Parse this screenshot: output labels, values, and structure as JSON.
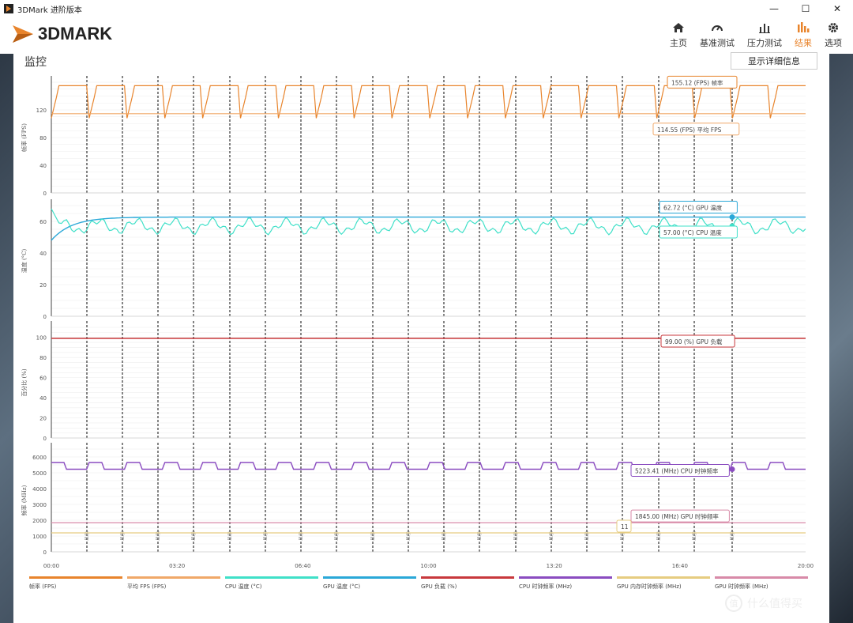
{
  "window": {
    "title": "3DMark 进阶版本",
    "min": "—",
    "max": "☐",
    "close": "✕"
  },
  "header": {
    "logo_text": "3DMARK"
  },
  "nav": [
    {
      "label": "主页",
      "icon": "home-icon"
    },
    {
      "label": "基准测试",
      "icon": "gauge-icon"
    },
    {
      "label": "压力测试",
      "icon": "bars-icon"
    },
    {
      "label": "结果",
      "icon": "results-icon",
      "active": true
    },
    {
      "label": "选项",
      "icon": "gear-icon"
    }
  ],
  "panel": {
    "title": "监控",
    "detail_button": "显示详细信息"
  },
  "colors": {
    "fps": "#e8842c",
    "fps_avg": "#f0a868",
    "cpu_temp": "#3fe0c8",
    "gpu_temp": "#2aa8d8",
    "gpu_load": "#c8383c",
    "cpu_clock": "#8a4cc0",
    "gpu_mem_clock": "#e6cc80",
    "gpu_clock": "#d88aa8",
    "accent": "#e8842c"
  },
  "x_axis": {
    "ticks": [
      "00:00",
      "03:20",
      "06:40",
      "10:00",
      "13:20",
      "16:40",
      "20:00"
    ]
  },
  "marker_label": "显示",
  "charts": [
    {
      "id": "fps",
      "ylabel": "帧率 (FPS)",
      "yticks": [
        "0",
        "40",
        "80",
        "120"
      ],
      "callouts": [
        {
          "text": "155.12 (FPS) 帧率",
          "color": "#e8842c"
        },
        {
          "text": "114.55 (FPS) 平均 FPS",
          "color": "#f0a868"
        }
      ]
    },
    {
      "id": "temp",
      "ylabel": "温度 (°C)",
      "yticks": [
        "0",
        "20",
        "40",
        "60"
      ],
      "callouts": [
        {
          "text": "62.72 (°C) GPU 温度",
          "color": "#2aa8d8"
        },
        {
          "text": "57.00 (°C) CPU 温度",
          "color": "#3fe0c8"
        }
      ]
    },
    {
      "id": "load",
      "ylabel": "百分比 (%)",
      "yticks": [
        "0",
        "20",
        "40",
        "60",
        "80",
        "100"
      ],
      "callouts": [
        {
          "text": "99.00 (%) GPU 负载",
          "color": "#c8383c"
        }
      ]
    },
    {
      "id": "clock",
      "ylabel": "频率 (MHz)",
      "yticks": [
        "0",
        "1000",
        "2000",
        "3000",
        "4000",
        "5000",
        "6000"
      ],
      "callouts": [
        {
          "text": "5223.41 (MHz) CPU 时钟频率",
          "color": "#8a4cc0"
        },
        {
          "text": "1845.00 (MHz) GPU 时钟频率",
          "color": "#d88aa8"
        },
        {
          "text": "11",
          "color": "#e6cc80"
        }
      ]
    }
  ],
  "legend": [
    {
      "label": "帧率 (FPS)",
      "color": "#e8842c"
    },
    {
      "label": "平均 FPS (FPS)",
      "color": "#f0a868"
    },
    {
      "label": "CPU 温度 (°C)",
      "color": "#3fe0c8"
    },
    {
      "label": "GPU 温度 (°C)",
      "color": "#2aa8d8"
    },
    {
      "label": "GPU 负载 (%)",
      "color": "#c8383c"
    },
    {
      "label": "CPU 时钟频率 (MHz)",
      "color": "#8a4cc0"
    },
    {
      "label": "GPU 内存时钟频率 (MHz)",
      "color": "#e6cc80"
    },
    {
      "label": "GPU 时钟频率 (MHz)",
      "color": "#d88aa8"
    }
  ],
  "chart_data": [
    {
      "type": "line",
      "ylabel": "帧率 (FPS)",
      "xlim": [
        "00:00",
        "20:00"
      ],
      "ylim": [
        0,
        160
      ],
      "series": [
        {
          "name": "帧率",
          "pattern": "oscillating",
          "min": 95,
          "max": 155,
          "last": 155.12
        },
        {
          "name": "平均 FPS",
          "values_constant": 114.55
        }
      ]
    },
    {
      "type": "line",
      "ylabel": "温度 (°C)",
      "ylim": [
        0,
        70
      ],
      "series": [
        {
          "name": "GPU 温度",
          "start": 48,
          "plateau": 62.72
        },
        {
          "name": "CPU 温度",
          "start": 68,
          "range": [
            53,
            64
          ],
          "last": 57.0
        }
      ]
    },
    {
      "type": "line",
      "ylabel": "百分比 (%)",
      "ylim": [
        0,
        110
      ],
      "series": [
        {
          "name": "GPU 负载",
          "values_constant": 99.0
        }
      ]
    },
    {
      "type": "line",
      "ylabel": "频率 (MHz)",
      "ylim": [
        0,
        6500
      ],
      "series": [
        {
          "name": "CPU 时钟频率",
          "range": [
            5223,
            5700
          ],
          "last": 5223.41
        },
        {
          "name": "GPU 时钟频率",
          "values_constant": 1845.0
        },
        {
          "name": "GPU 内存时钟频率",
          "values_constant": 1200
        }
      ]
    }
  ],
  "watermark": {
    "text": "什么值得买",
    "symbol": "值"
  }
}
